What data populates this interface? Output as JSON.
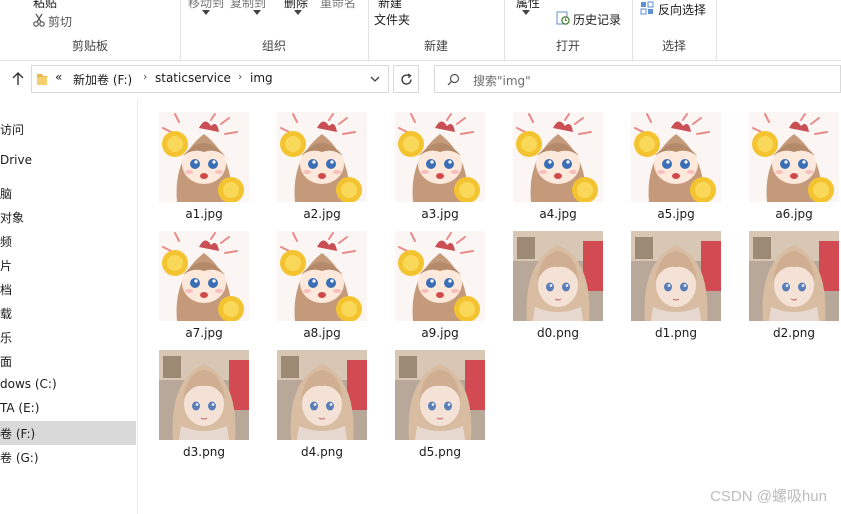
{
  "ribbon": {
    "clipboard": {
      "paste": "粘贴",
      "cut": "剪切",
      "group": "剪贴板"
    },
    "organize": {
      "move_to": "移动到",
      "copy_to": "复制到",
      "delete": "删除",
      "rename": "重命名",
      "group": "组织"
    },
    "new": {
      "new_folder_line1": "新建",
      "new_folder_line2": "文件夹",
      "group": "新建"
    },
    "open": {
      "properties": "属性",
      "history": "历史记录",
      "group": "打开"
    },
    "select": {
      "invert": "反向选择",
      "group": "选择"
    }
  },
  "address": {
    "overflow": "«",
    "segments": [
      "新加卷 (F:)",
      "staticservice",
      "img"
    ],
    "search_placeholder": "搜索\"img\""
  },
  "nav": {
    "items": [
      {
        "label": "访问"
      },
      {
        "label": "Drive"
      },
      {
        "label": "脑"
      },
      {
        "label": "对象"
      },
      {
        "label": "频"
      },
      {
        "label": "片"
      },
      {
        "label": "档"
      },
      {
        "label": "载"
      },
      {
        "label": "乐"
      },
      {
        "label": "面"
      },
      {
        "label": "dows (C:)"
      },
      {
        "label": "TA (E:)"
      },
      {
        "label": "卷 (F:)"
      },
      {
        "label": "卷 (G:)"
      }
    ],
    "selected_index": 12
  },
  "files": [
    {
      "name": "a1.jpg",
      "kind": "cheer"
    },
    {
      "name": "a2.jpg",
      "kind": "cheer"
    },
    {
      "name": "a3.jpg",
      "kind": "cheer"
    },
    {
      "name": "a4.jpg",
      "kind": "cheer"
    },
    {
      "name": "a5.jpg",
      "kind": "cheer"
    },
    {
      "name": "a6.jpg",
      "kind": "cheer"
    },
    {
      "name": "a7.jpg",
      "kind": "cheer"
    },
    {
      "name": "a8.jpg",
      "kind": "cheer"
    },
    {
      "name": "a9.jpg",
      "kind": "cheer"
    },
    {
      "name": "d0.png",
      "kind": "portrait"
    },
    {
      "name": "d1.png",
      "kind": "portrait"
    },
    {
      "name": "d2.png",
      "kind": "portrait"
    },
    {
      "name": "d3.png",
      "kind": "portrait"
    },
    {
      "name": "d4.png",
      "kind": "portrait"
    },
    {
      "name": "d5.png",
      "kind": "portrait"
    }
  ],
  "watermark": "CSDN @螺吸hun",
  "colors": {
    "selection": "#d9d9d9",
    "border": "#d9d9d9",
    "folder": "#e8b84a"
  }
}
